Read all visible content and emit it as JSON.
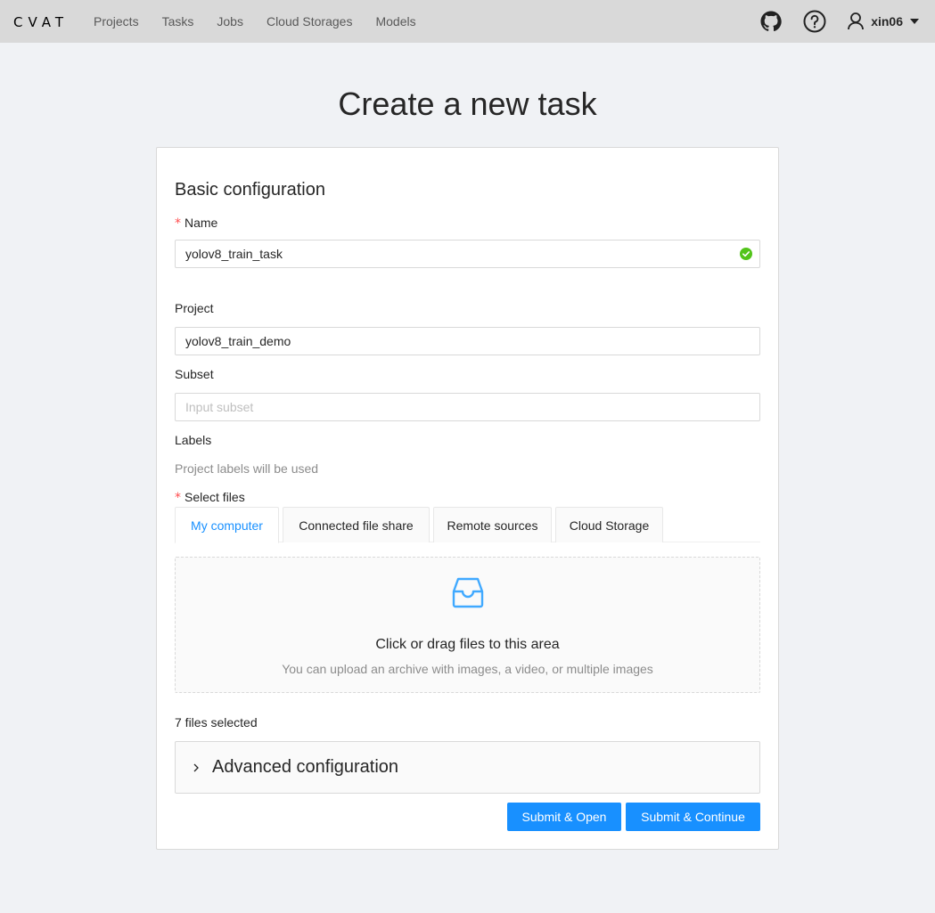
{
  "app": {
    "logo_text": "CVAT"
  },
  "nav": {
    "items": [
      {
        "label": "Projects"
      },
      {
        "label": "Tasks"
      },
      {
        "label": "Jobs"
      },
      {
        "label": "Cloud Storages"
      },
      {
        "label": "Models"
      }
    ]
  },
  "header": {
    "username": "xin06"
  },
  "page": {
    "title": "Create a new task"
  },
  "form": {
    "section_title": "Basic configuration",
    "name": {
      "label": "Name",
      "value": "yolov8_train_task"
    },
    "project": {
      "label": "Project",
      "value": "yolov8_train_demo"
    },
    "subset": {
      "label": "Subset",
      "placeholder": "Input subset"
    },
    "labels": {
      "label": "Labels",
      "hint": "Project labels will be used"
    },
    "select_files": {
      "label": "Select files",
      "tabs": [
        {
          "label": "My computer",
          "active": true
        },
        {
          "label": "Connected file share",
          "active": false
        },
        {
          "label": "Remote sources",
          "active": false
        },
        {
          "label": "Cloud Storage",
          "active": false
        }
      ],
      "dropzone_text": "Click or drag files to this area",
      "dropzone_hint": "You can upload an archive with images, a video, or multiple images",
      "status": "7 files selected"
    },
    "advanced": {
      "label": "Advanced configuration"
    },
    "buttons": {
      "submit_open": "Submit & Open",
      "submit_continue": "Submit & Continue"
    }
  },
  "colors": {
    "primary": "#1890ff",
    "success": "#52c41a",
    "required": "#ff4d4f",
    "header_bg": "#d9d9d9",
    "page_bg": "#f0f2f5"
  },
  "icons": [
    "github-icon",
    "help-icon",
    "user-icon",
    "caret-down-icon",
    "check-circle-icon",
    "inbox-icon",
    "chevron-right-icon"
  ]
}
